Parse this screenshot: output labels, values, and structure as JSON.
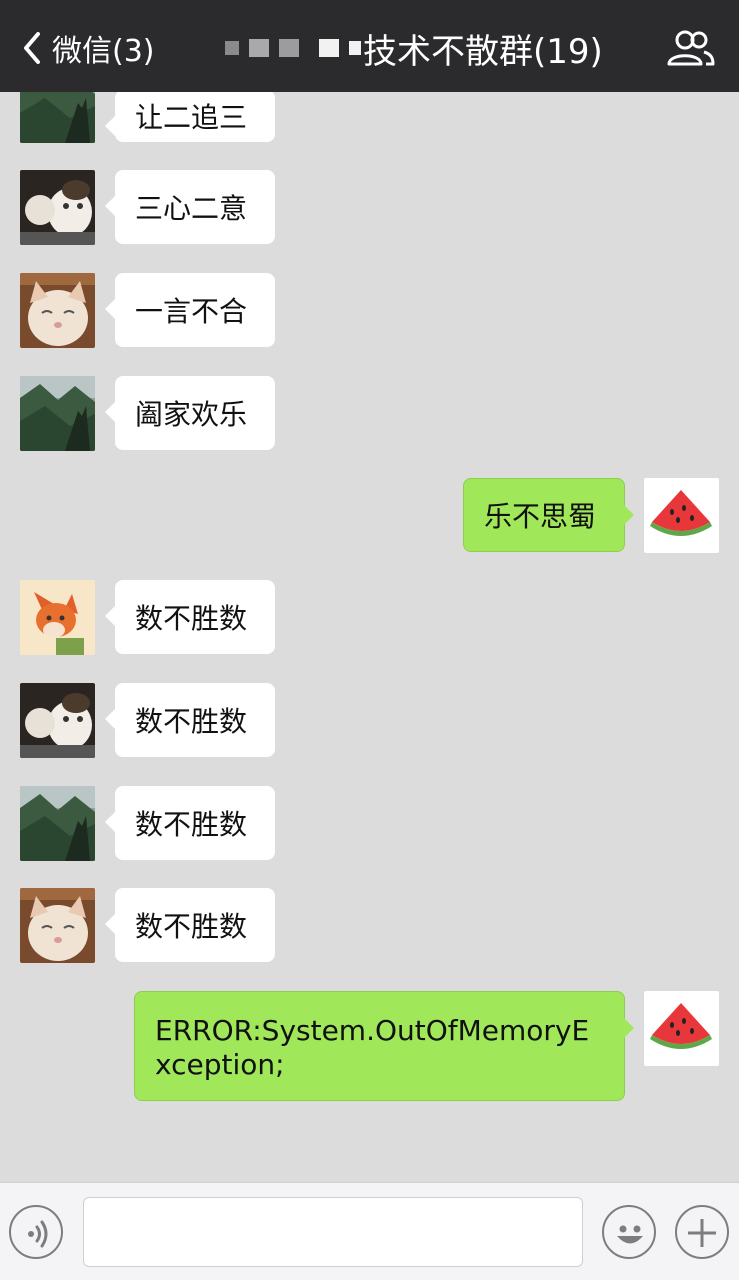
{
  "header": {
    "back_label": "微信(3)",
    "title": "技术不散群(19)"
  },
  "messages": [
    {
      "side": "in",
      "avatar": "landscape-avatar",
      "text": "让二追三"
    },
    {
      "side": "in",
      "avatar": "cat-paw-avatar",
      "text": "三心二意"
    },
    {
      "side": "in",
      "avatar": "smiling-cat-avatar",
      "text": "一言不合"
    },
    {
      "side": "in",
      "avatar": "landscape-avatar",
      "text": "阖家欢乐"
    },
    {
      "side": "out",
      "avatar": "watermelon-avatar",
      "text": "乐不思蜀"
    },
    {
      "side": "in",
      "avatar": "fox-avatar",
      "text": "数不胜数"
    },
    {
      "side": "in",
      "avatar": "cat-paw-avatar",
      "text": "数不胜数"
    },
    {
      "side": "in",
      "avatar": "landscape-avatar",
      "text": "数不胜数"
    },
    {
      "side": "in",
      "avatar": "smiling-cat-avatar",
      "text": "数不胜数"
    },
    {
      "side": "out",
      "avatar": "watermelon-avatar",
      "text": "ERROR:System.OutOfMemoryException;"
    }
  ],
  "footer": {
    "voice_icon": "voice-icon",
    "emoji_icon": "emoji-icon",
    "plus_icon": "plus-icon",
    "input_value": ""
  },
  "colors": {
    "header_bg": "#2b2b2d",
    "chat_bg": "#dcdcdc",
    "outgoing_bubble": "#a0e75a",
    "incoming_bubble": "#ffffff"
  }
}
